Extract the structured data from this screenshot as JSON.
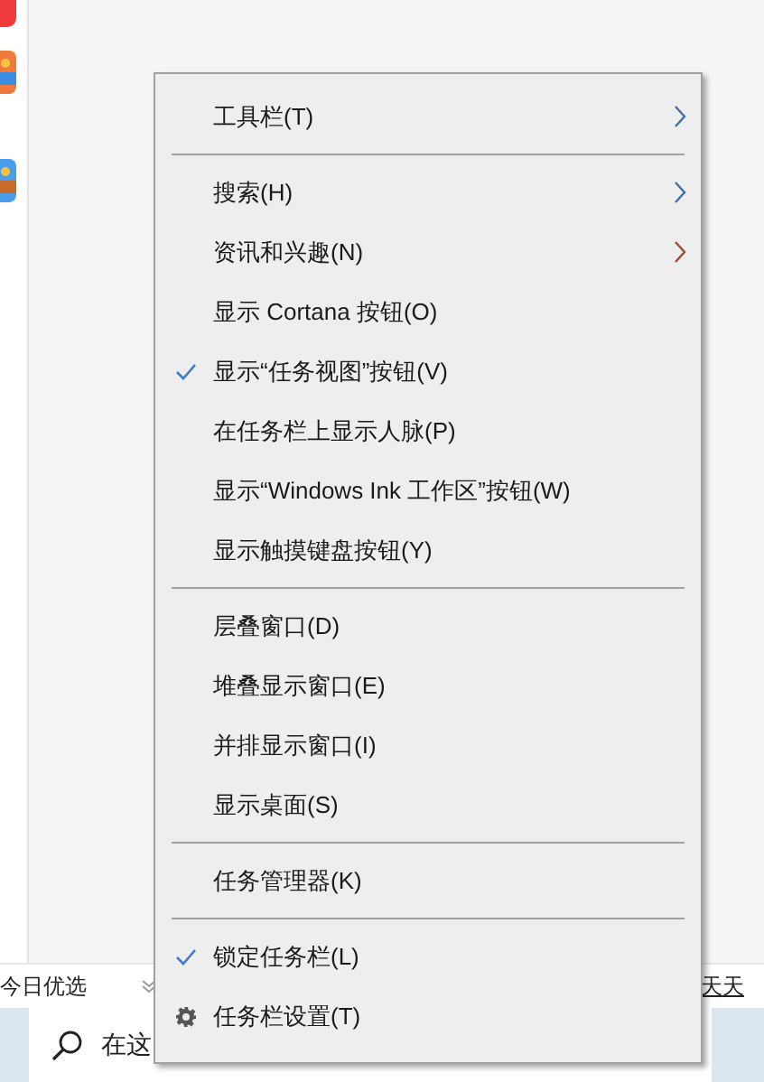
{
  "news_bar": {
    "title": "今日优选",
    "link": "天天"
  },
  "search": {
    "placeholder": "在这"
  },
  "context_menu": {
    "items": [
      {
        "kind": "submenu",
        "label": "工具栏(T)",
        "color": "#3f6fa8"
      },
      {
        "kind": "separator"
      },
      {
        "kind": "submenu",
        "label": "搜索(H)",
        "color": "#3f6fa8"
      },
      {
        "kind": "submenu",
        "label": "资讯和兴趣(N)",
        "color": "#a04a2a"
      },
      {
        "kind": "command",
        "label": "显示 Cortana 按钮(O)",
        "checked": false
      },
      {
        "kind": "command",
        "label": "显示“任务视图”按钮(V)",
        "checked": true
      },
      {
        "kind": "command",
        "label": "在任务栏上显示人脉(P)",
        "checked": false
      },
      {
        "kind": "command",
        "label": "显示“Windows Ink 工作区”按钮(W)",
        "checked": false
      },
      {
        "kind": "command",
        "label": "显示触摸键盘按钮(Y)",
        "checked": false
      },
      {
        "kind": "separator"
      },
      {
        "kind": "command",
        "label": "层叠窗口(D)",
        "checked": false
      },
      {
        "kind": "command",
        "label": "堆叠显示窗口(E)",
        "checked": false
      },
      {
        "kind": "command",
        "label": "并排显示窗口(I)",
        "checked": false
      },
      {
        "kind": "command",
        "label": "显示桌面(S)",
        "checked": false
      },
      {
        "kind": "separator"
      },
      {
        "kind": "command",
        "label": "任务管理器(K)",
        "checked": false
      },
      {
        "kind": "separator"
      },
      {
        "kind": "command",
        "label": "锁定任务栏(L)",
        "checked": true
      },
      {
        "kind": "settings",
        "label": "任务栏设置(T)"
      }
    ]
  }
}
